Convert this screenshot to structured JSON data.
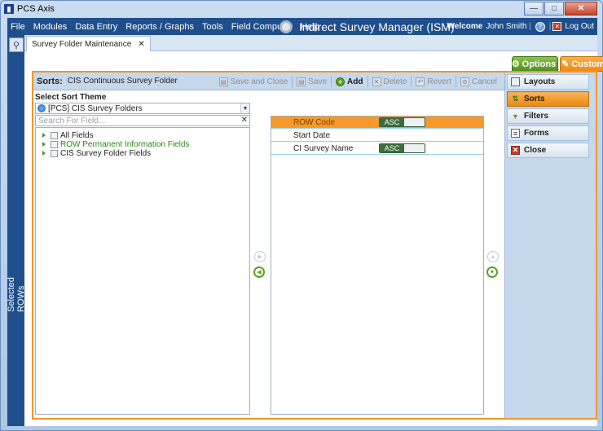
{
  "window": {
    "title": "PCS Axis",
    "app_icon": "pcs-axis-icon",
    "controls": {
      "minimize": "—",
      "maximize": "□",
      "close": "✕"
    }
  },
  "menubar": {
    "items": [
      "File",
      "Modules",
      "Data Entry",
      "Reports / Graphs",
      "Tools",
      "Field Computer",
      "Help"
    ],
    "app_title": "Indirect Survey Manager (ISM)",
    "welcome_label": "Welcome",
    "user_name": "John Smith",
    "logout_label": "Log Out"
  },
  "left_strip": {
    "label": "Selected ROWs"
  },
  "doc_tab": {
    "label": "Survey Folder Maintenance",
    "close": "✕"
  },
  "top_buttons": {
    "options": "Options",
    "customize": "Customize"
  },
  "panel_header": {
    "label": "Sorts:",
    "folder": "CIS Continuous Survey Folder",
    "toolbar": {
      "save_and_close": "Save and Close",
      "save": "Save",
      "add": "Add",
      "delete": "Delete",
      "revert": "Revert",
      "cancel": "Cancel"
    }
  },
  "theme": {
    "label": "Select Sort Theme",
    "selected": "[PCS] CIS Survey Folders",
    "search_placeholder": "Search For Field..."
  },
  "tree": [
    {
      "label": "All Fields",
      "highlight": false
    },
    {
      "label": "ROW Permanent Information Fields",
      "highlight": true
    },
    {
      "label": "CIS Survey Folder Fields",
      "highlight": false
    }
  ],
  "sort_fields": [
    {
      "name": "ROW Code",
      "order": "ASC",
      "selected": true
    },
    {
      "name": "Start Date",
      "order": "",
      "selected": false
    },
    {
      "name": "CI Survey Name",
      "order": "ASC",
      "selected": false
    }
  ],
  "side_menu": [
    {
      "label": "Layouts",
      "icon": "layouts-icon",
      "active": false
    },
    {
      "label": "Sorts",
      "icon": "sorts-icon",
      "active": true
    },
    {
      "label": "Filters",
      "icon": "filter-icon",
      "active": false
    },
    {
      "label": "Forms",
      "icon": "forms-icon",
      "active": false
    },
    {
      "label": "Close",
      "icon": "close-icon",
      "active": false
    }
  ],
  "colors": {
    "accent": "#f0962a",
    "menu_bg": "#1f4e8c",
    "green": "#58a322"
  }
}
